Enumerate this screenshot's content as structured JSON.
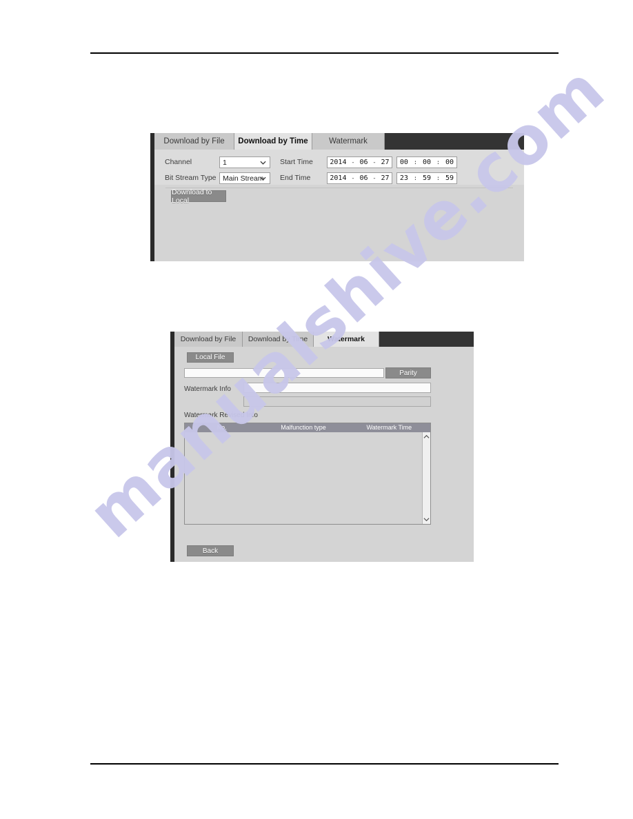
{
  "document": {
    "header_rule": "",
    "footer_rule": ""
  },
  "watermark_overlay": {
    "text": "manualshive.com",
    "color": "#c8c7ea"
  },
  "colors": {
    "tabbar_dark": "#343434",
    "panel_body": "#d4d4d4",
    "form_area": "#dcdcdc",
    "tab_inactive": "#c9c9c9",
    "tab_active": "#e3e3e3",
    "button_gray": "#8a8a8a",
    "table_header": "#8e8e99"
  },
  "panel_one": {
    "tabs": [
      {
        "label": "Download by File",
        "active": false
      },
      {
        "label": "Download by Time",
        "active": true
      },
      {
        "label": "Watermark",
        "active": false
      }
    ],
    "fields": {
      "channel_label": "Channel",
      "channel_value": "1",
      "bitstream_label": "Bit Stream Type",
      "bitstream_value": "Main Stream",
      "start_time_label": "Start Time",
      "end_time_label": "End Time"
    },
    "start_date": {
      "year": "2014",
      "month": "06",
      "day": "27",
      "sep1": "-",
      "sep2": "-"
    },
    "start_time": {
      "hour": "00",
      "minute": "00",
      "second": "00",
      "sep1": ":",
      "sep2": ":"
    },
    "end_date": {
      "year": "2014",
      "month": "06",
      "day": "27",
      "sep1": "-",
      "sep2": "-"
    },
    "end_time": {
      "hour": "23",
      "minute": "59",
      "second": "59",
      "sep1": ":",
      "sep2": ":"
    },
    "buttons": {
      "download_to_local": "Download to Local"
    }
  },
  "panel_two": {
    "tabs": [
      {
        "label": "Download by File",
        "active": false
      },
      {
        "label": "Download by Time",
        "active": false
      },
      {
        "label": "Watermark",
        "active": true
      }
    ],
    "buttons": {
      "local_file": "Local File",
      "parity": "Parity",
      "back": "Back"
    },
    "fields": {
      "file_path_value": "",
      "watermark_info_label": "Watermark Info",
      "watermark_info_value": "",
      "watermark_info_value2": "",
      "revised_info_label": "Watermark Revised Info"
    },
    "table": {
      "columns": [
        "No.",
        "Malfunction type",
        "Watermark Time"
      ],
      "rows": []
    }
  }
}
